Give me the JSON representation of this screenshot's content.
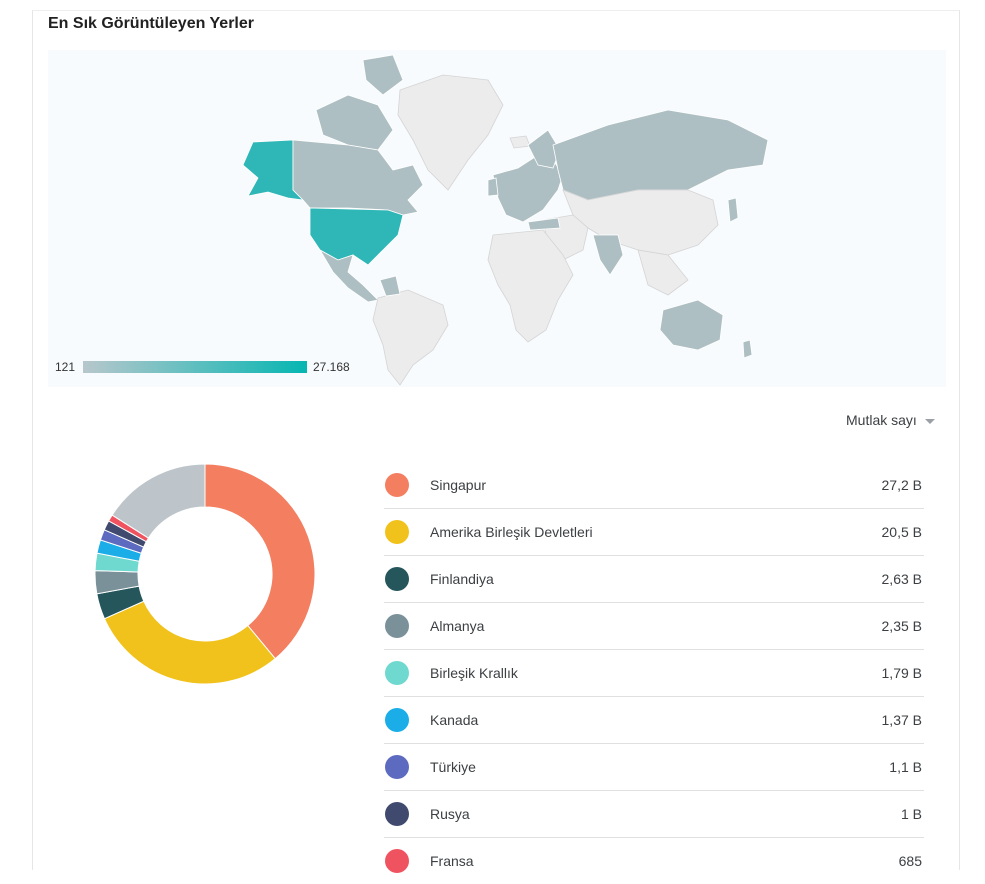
{
  "section_title": "En Sık Görüntüleyen Yerler",
  "map_legend": {
    "min_label": "121",
    "max_label": "27.168",
    "color_low": "#b7c7cc",
    "color_high": "#06b6b2"
  },
  "metric_selector": {
    "label": "Mutlak sayı",
    "icon": "caret-down-icon"
  },
  "chart_data": {
    "type": "pie",
    "style": "donut",
    "categories": [
      "Singapur",
      "Amerika Birleşik Devletleri",
      "Finlandiya",
      "Almanya",
      "Birleşik Krallık",
      "Kanada",
      "Türkiye",
      "Rusya",
      "Fransa"
    ],
    "labels": [
      "27,2 B",
      "20,5 B",
      "2,63 B",
      "2,35 B",
      "1,79 B",
      "1,37 B",
      "1,1 B",
      "1 B",
      "685"
    ],
    "values": [
      27200,
      20500,
      2630,
      2350,
      1790,
      1370,
      1100,
      1000,
      685
    ],
    "other_share_percent": 16,
    "colors": [
      "#f47e60",
      "#f1c21b",
      "#24565c",
      "#7a9199",
      "#6fd8cf",
      "#1aade8",
      "#5c6bc0",
      "#3f4a6e",
      "#ef5360"
    ],
    "other_color": "#bdc5cb"
  }
}
